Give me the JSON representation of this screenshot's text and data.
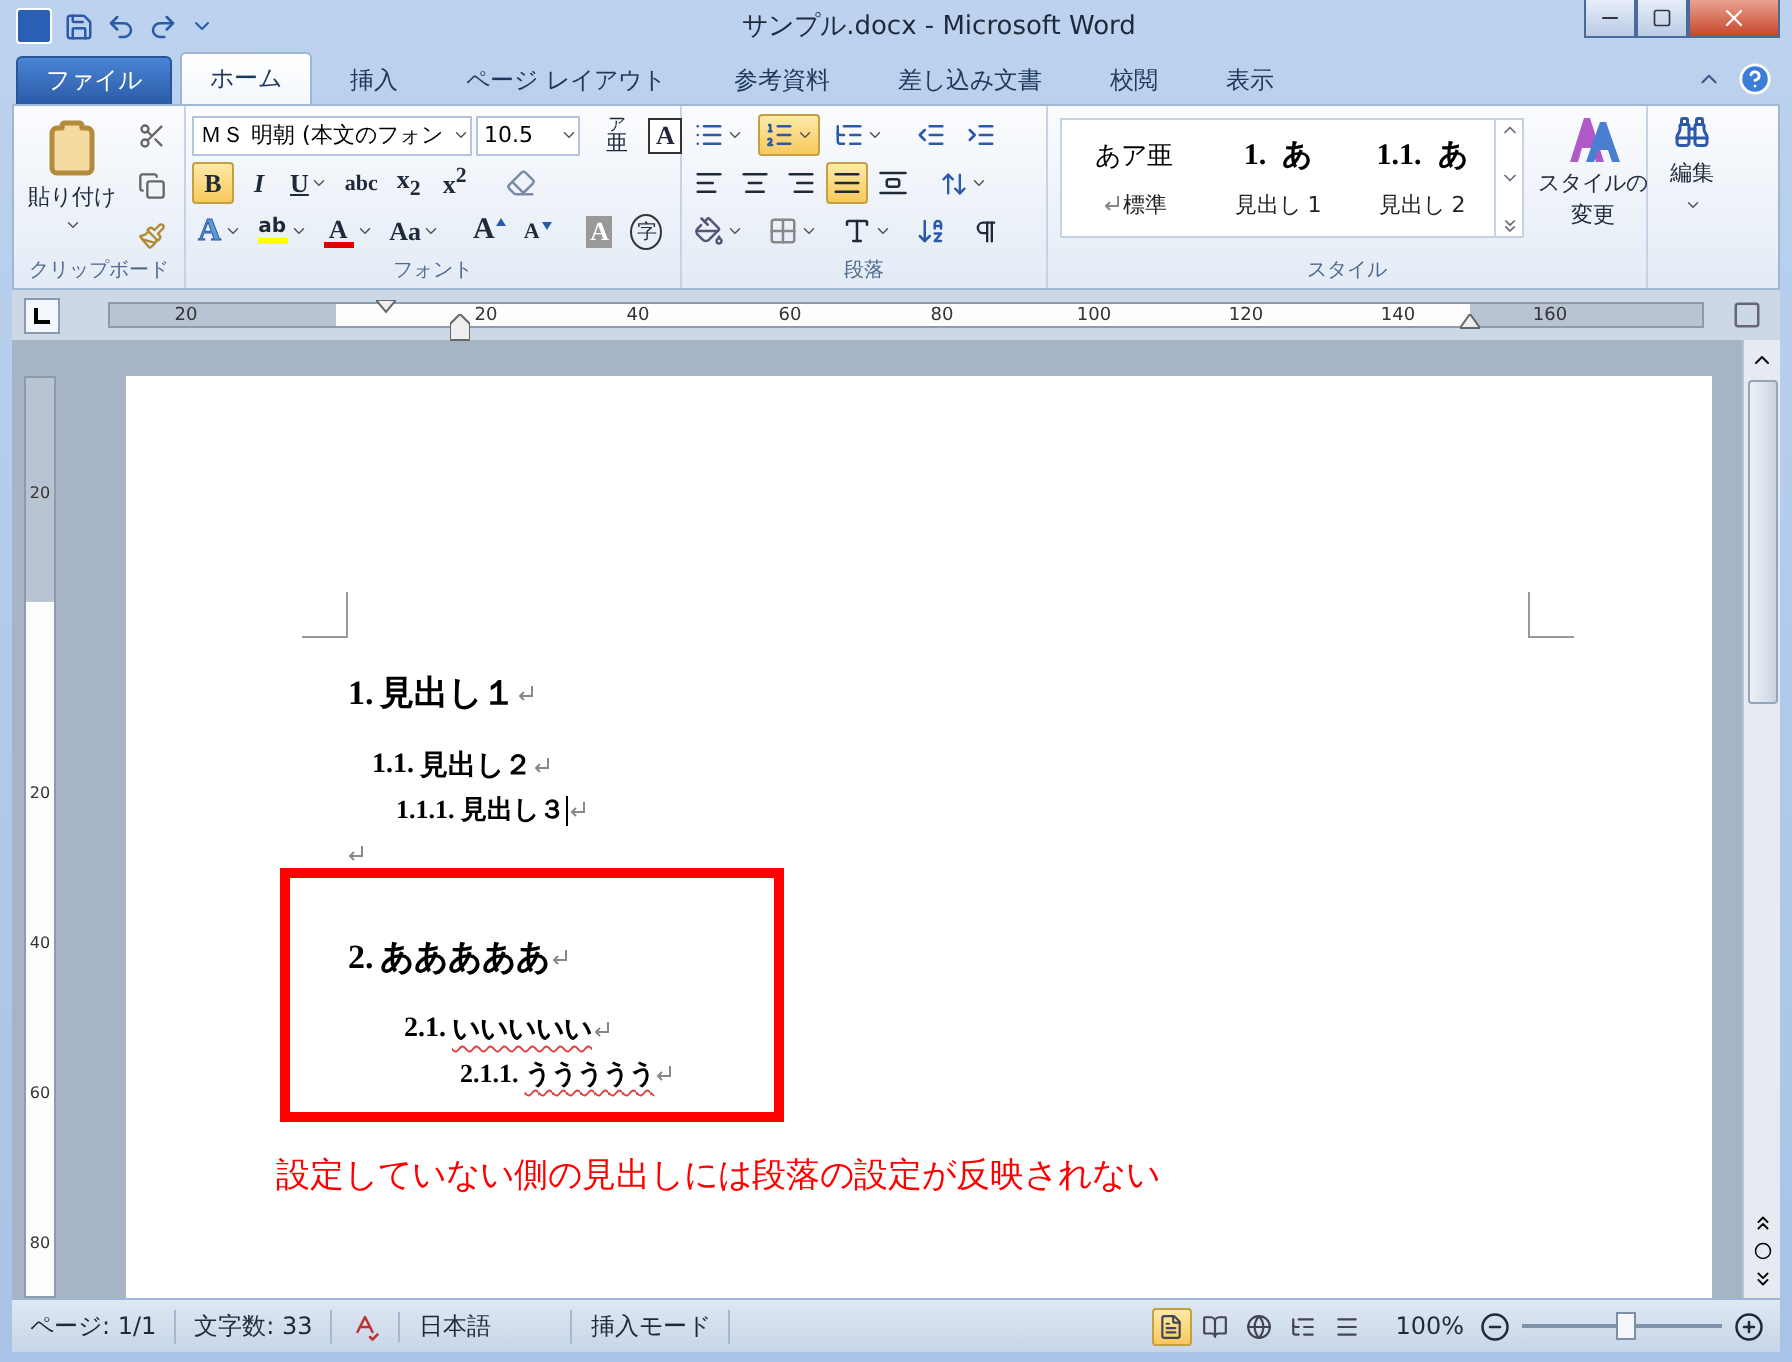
{
  "window": {
    "title": "サンプル.docx - Microsoft Word"
  },
  "tabs": [
    {
      "label": "ファイル",
      "kind": "file",
      "selected": false
    },
    {
      "label": "ホーム",
      "kind": "tab",
      "selected": true
    },
    {
      "label": "挿入",
      "kind": "tab",
      "selected": false
    },
    {
      "label": "ページ レイアウト",
      "kind": "tab",
      "selected": false
    },
    {
      "label": "参考資料",
      "kind": "tab",
      "selected": false
    },
    {
      "label": "差し込み文書",
      "kind": "tab",
      "selected": false
    },
    {
      "label": "校閲",
      "kind": "tab",
      "selected": false
    },
    {
      "label": "表示",
      "kind": "tab",
      "selected": false
    }
  ],
  "ribbon": {
    "clipboard": {
      "paste_label": "貼り付け",
      "group_label": "クリップボード"
    },
    "font": {
      "font_name": "ＭＳ 明朝 (本文のフォン",
      "font_size": "10.5",
      "ruby_top": "ア",
      "ruby_base": "亜",
      "border_label": "A",
      "format_buttons": [
        {
          "label": "B",
          "kind": "bold",
          "selected": true
        },
        {
          "label": "I",
          "kind": "italic",
          "selected": false
        },
        {
          "label": "U",
          "kind": "underline",
          "selected": false
        },
        {
          "label": "abc",
          "kind": "strike",
          "selected": false
        },
        {
          "label": "x$_{2}$",
          "kind": "script",
          "selected": false
        },
        {
          "label": "x$^{2}$",
          "kind": "script",
          "selected": false
        }
      ],
      "effect_buttons": [
        {
          "label": "A",
          "kind": "text_effect"
        },
        {
          "label": "ab",
          "kind": "highlight",
          "color": "#ffff00"
        },
        {
          "label": "A",
          "kind": "font_color",
          "color": "#e00000"
        },
        {
          "label": "Aa",
          "kind": "case"
        },
        {
          "label": "A",
          "kind": "grow"
        },
        {
          "label": "A",
          "kind": "shrink"
        },
        {
          "label": "A",
          "kind": "shading"
        },
        {
          "label": "字",
          "kind": "enclose"
        }
      ],
      "group_label": "フォント"
    },
    "paragraph": {
      "numbering_selected": true,
      "alignments": [
        {
          "kind": "left",
          "selected": false
        },
        {
          "kind": "center",
          "selected": false
        },
        {
          "kind": "right",
          "selected": false
        },
        {
          "kind": "justify",
          "selected": true
        },
        {
          "kind": "distributed",
          "selected": false
        }
      ],
      "group_label": "段落"
    },
    "styles": {
      "items": [
        {
          "preview": "あア亜",
          "name": "標準",
          "kind": "normal"
        },
        {
          "number": "1.",
          "preview": "あ",
          "name": "見出し 1",
          "kind": "heading"
        },
        {
          "number": "1.1.",
          "preview": "あ",
          "name": "見出し 2",
          "kind": "heading"
        }
      ],
      "change_label": "スタイルの",
      "change_label_2": "変更",
      "group_label": "スタイル"
    },
    "editing": {
      "label": "編集"
    }
  },
  "ruler": {
    "horizontal_labels": [
      "20",
      "20",
      "40",
      "60",
      "80",
      "100",
      "120",
      "140",
      "160"
    ],
    "vertical_labels": [
      "20",
      "20",
      "40",
      "60",
      "80"
    ]
  },
  "document": {
    "blocks": [
      {
        "kind": "outline",
        "headings": [
          {
            "number": "1.",
            "text": "見出し１",
            "cursor": false,
            "spelling_error": false,
            "children": [
              {
                "number": "1.1.",
                "text": "見出し２",
                "cursor": false,
                "spelling_error": false,
                "children": [
                  {
                    "number": "1.1.1.",
                    "text": "見出し３",
                    "cursor": true,
                    "spelling_error": false
                  }
                ]
              }
            ]
          }
        ]
      },
      {
        "kind": "blank"
      },
      {
        "kind": "highlighted_outline",
        "headings": [
          {
            "number": "2.",
            "text": "あああああ",
            "cursor": false,
            "spelling_error": false,
            "children": [
              {
                "number": "2.1.",
                "text": "いいいいい",
                "cursor": false,
                "spelling_error": true,
                "children": [
                  {
                    "number": "2.1.1.",
                    "text": "ううううう",
                    "cursor": false,
                    "spelling_error": true
                  }
                ]
              }
            ]
          }
        ]
      }
    ],
    "annotation": "設定していない側の見出しには段落の設定が反映されない"
  },
  "status_bar": {
    "page": "ページ: 1/1",
    "word_count": "文字数: 33",
    "language": "日本語",
    "mode": "挿入モード",
    "views": [
      {
        "kind": "print",
        "selected": true
      },
      {
        "kind": "reading",
        "selected": false
      },
      {
        "kind": "web",
        "selected": false
      },
      {
        "kind": "outline",
        "selected": false
      },
      {
        "kind": "draft",
        "selected": false
      }
    ],
    "zoom": "100%",
    "zoom_slider": {
      "level": 0.52
    }
  }
}
